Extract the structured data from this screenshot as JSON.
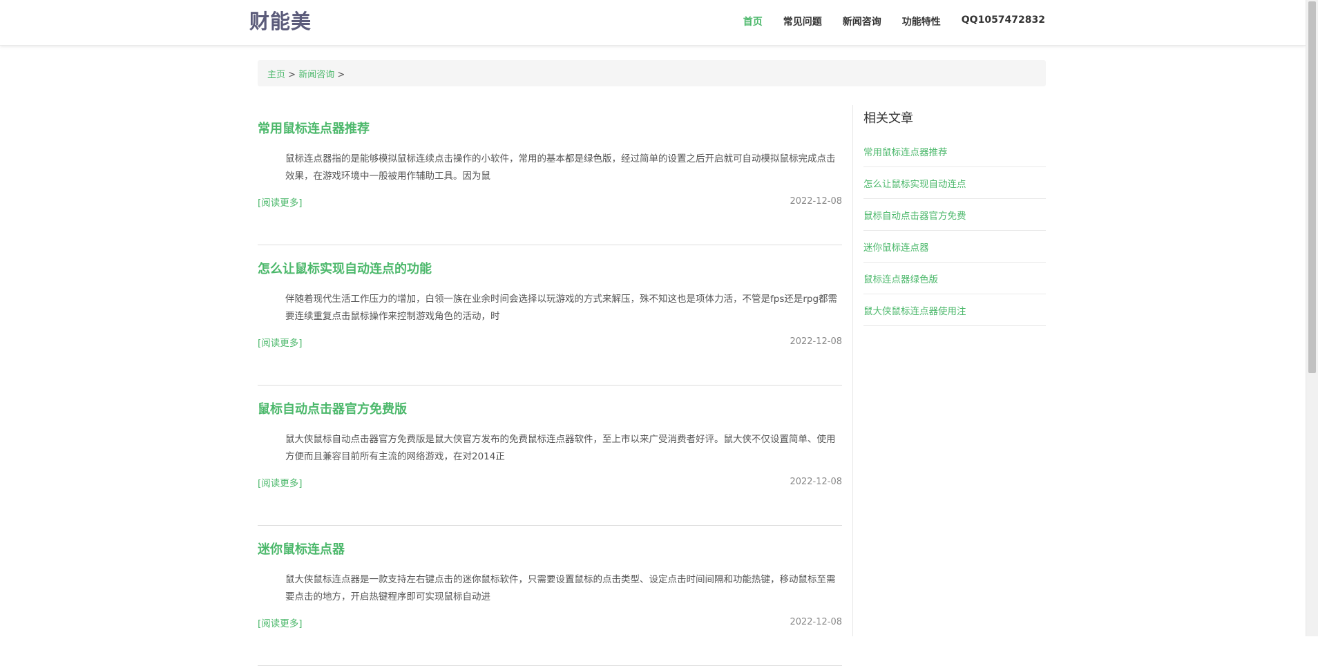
{
  "header": {
    "logo": "财能美",
    "nav": [
      {
        "label": "首页",
        "active": true
      },
      {
        "label": "常见问题",
        "active": false
      },
      {
        "label": "新闻咨询",
        "active": false
      },
      {
        "label": "功能特性",
        "active": false
      },
      {
        "label": "QQ1057472832",
        "active": false
      }
    ]
  },
  "breadcrumb": {
    "home": "主页",
    "separator1": " > ",
    "section": "新闻咨询",
    "separator2": " >"
  },
  "articles": [
    {
      "title": "常用鼠标连点器推荐",
      "summary": "鼠标连点器指的是能够模拟鼠标连续点击操作的小软件，常用的基本都是绿色版，经过简单的设置之后开启就可自动模拟鼠标完成点击效果，在游戏环境中一般被用作辅助工具。因为鼠",
      "more": "[阅读更多]",
      "date": "2022-12-08"
    },
    {
      "title": "怎么让鼠标实现自动连点的功能",
      "summary": "伴随着现代生活工作压力的增加，白领一族在业余时间会选择以玩游戏的方式来解压，殊不知这也是项体力活，不管是fps还是rpg都需要连续重复点击鼠标操作来控制游戏角色的活动，时",
      "more": "[阅读更多]",
      "date": "2022-12-08"
    },
    {
      "title": "鼠标自动点击器官方免费版",
      "summary": "鼠大侠鼠标自动点击器官方免费版是鼠大侠官方发布的免费鼠标连点器软件，至上市以来广受消费者好评。鼠大侠不仅设置简单、使用方便而且兼容目前所有主流的网络游戏，在对2014正",
      "more": "[阅读更多]",
      "date": "2022-12-08"
    },
    {
      "title": "迷你鼠标连点器",
      "summary": "鼠大侠鼠标连点器是一款支持左右键点击的迷你鼠标软件，只需要设置鼠标的点击类型、设定点击时间间隔和功能热键，移动鼠标至需要点击的地方，开启热键程序即可实现鼠标自动进",
      "more": "[阅读更多]",
      "date": "2022-12-08"
    }
  ],
  "sidebar": {
    "title": "相关文章",
    "links": [
      "常用鼠标连点器推荐",
      "怎么让鼠标实现自动连点",
      "鼠标自动点击器官方免费",
      "迷你鼠标连点器",
      "鼠标连点器绿色版",
      "鼠大侠鼠标连点器使用注"
    ]
  },
  "colors": {
    "accent": "#4cb86b",
    "logo": "#5b5b7a",
    "breadcrumb_bg": "#f5f5f5"
  }
}
